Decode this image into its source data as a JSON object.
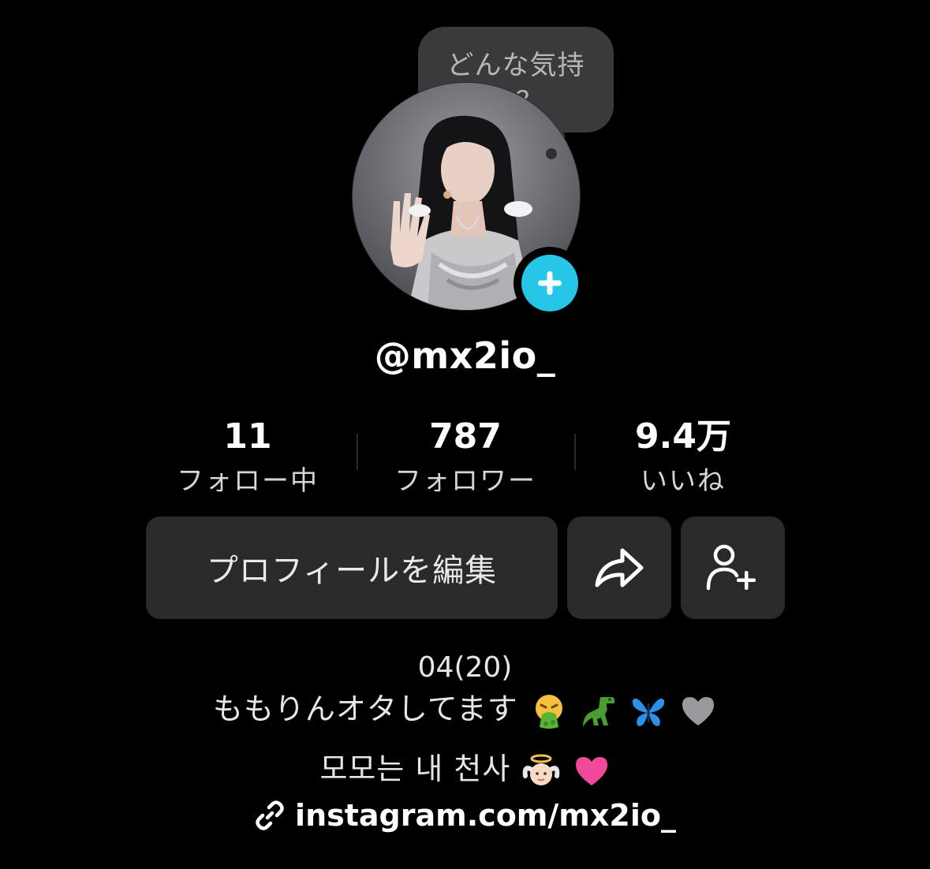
{
  "profile": {
    "mood_bubble": "どんな気持ち？",
    "username": "@mx2io_"
  },
  "stats": {
    "following": {
      "value": "11",
      "label": "フォロー中"
    },
    "followers": {
      "value": "787",
      "label": "フォロワー"
    },
    "likes": {
      "value": "9.4万",
      "label": "いいね"
    }
  },
  "actions": {
    "edit_profile": "プロフィールを編集"
  },
  "bio": {
    "line1": "04(20)",
    "line2": "ももりんオタしてます",
    "line3": "모모는 내 천사",
    "link": "instagram.com/mx2io_"
  },
  "colors": {
    "accent": "#25c6e8",
    "button_bg": "#2a2a2c",
    "bubble_bg": "#3a3a3c"
  }
}
